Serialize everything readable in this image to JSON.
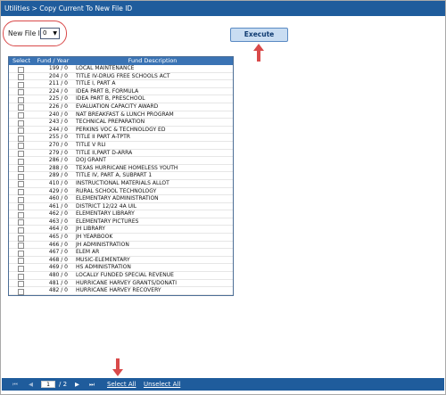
{
  "titlebar": {
    "title": "Utilities > Copy Current To New File ID"
  },
  "file_id": {
    "label": "New File ID:",
    "value": "0"
  },
  "execute_label": "Execute",
  "grid": {
    "headers": [
      "Select",
      "Fund / Year",
      "Fund Description"
    ],
    "rows": [
      {
        "fund": "199 / 0",
        "desc": "LOCAL MAINTENANCE"
      },
      {
        "fund": "204 / 0",
        "desc": "TITLE IV-DRUG FREE SCHOOLS ACT"
      },
      {
        "fund": "211 / 0",
        "desc": "TITLE I, PART A"
      },
      {
        "fund": "224 / 0",
        "desc": "IDEA PART B, FORMULA"
      },
      {
        "fund": "225 / 0",
        "desc": "IDEA PART B, PRESCHOOL"
      },
      {
        "fund": "226 / 0",
        "desc": "EVALUATION CAPACITY AWARD"
      },
      {
        "fund": "240 / 0",
        "desc": "NAT BREAKFAST & LUNCH PROGRAM"
      },
      {
        "fund": "243 / 0",
        "desc": "TECHNICAL PREPARATION"
      },
      {
        "fund": "244 / 0",
        "desc": "PERKINS VOC & TECHNOLOGY ED"
      },
      {
        "fund": "255 / 0",
        "desc": "TITLE II PART A-TPTR"
      },
      {
        "fund": "270 / 0",
        "desc": "TITLE V RLI"
      },
      {
        "fund": "279 / 0",
        "desc": "TITLE II,PART D-ARRA"
      },
      {
        "fund": "286 / 0",
        "desc": "DOJ GRANT"
      },
      {
        "fund": "288 / 0",
        "desc": "TEXAS HURRICANE HOMELESS YOUTH"
      },
      {
        "fund": "289 / 0",
        "desc": "TITLE IV, PART A, SUBPART 1"
      },
      {
        "fund": "410 / 0",
        "desc": "INSTRUCTIONAL MATERIALS ALLOT"
      },
      {
        "fund": "429 / 0",
        "desc": "RURAL SCHOOL TECHNOLOGY"
      },
      {
        "fund": "460 / 0",
        "desc": "ELEMENTARY ADMINISTRATION"
      },
      {
        "fund": "461 / 0",
        "desc": "DISTRICT 12/22 4A UIL"
      },
      {
        "fund": "462 / 0",
        "desc": "ELEMENTARY LIBRARY"
      },
      {
        "fund": "463 / 0",
        "desc": "ELEMENTARY PICTURES"
      },
      {
        "fund": "464 / 0",
        "desc": "JH LIBRARY"
      },
      {
        "fund": "465 / 0",
        "desc": "JH YEARBOOK"
      },
      {
        "fund": "466 / 0",
        "desc": "JH ADMINISTRATION"
      },
      {
        "fund": "467 / 0",
        "desc": "ELEM AR"
      },
      {
        "fund": "468 / 0",
        "desc": "MUSIC-ELEMENTARY"
      },
      {
        "fund": "469 / 0",
        "desc": "HS ADMINISTRATION"
      },
      {
        "fund": "480 / 0",
        "desc": "LOCALLY FUNDED SPECIAL REVENUE"
      },
      {
        "fund": "481 / 0",
        "desc": "HURRICANE HARVEY GRANTS/DONATI"
      },
      {
        "fund": "482 / 0",
        "desc": "HURRICANE HARVEY RECOVERY"
      }
    ]
  },
  "pager": {
    "first": "⏮",
    "prev": "◀",
    "page": "1",
    "total": "/ 2",
    "next": "▶",
    "last": "⏭",
    "select_all": "Select All",
    "unselect_all": "Unselect All"
  },
  "colors": {
    "header_blue": "#1f5c9c",
    "annotation_red": "#d94a4a",
    "execute_bg": "#c9ddf2"
  },
  "icons": {
    "arrow": "red-arrow-icon"
  }
}
